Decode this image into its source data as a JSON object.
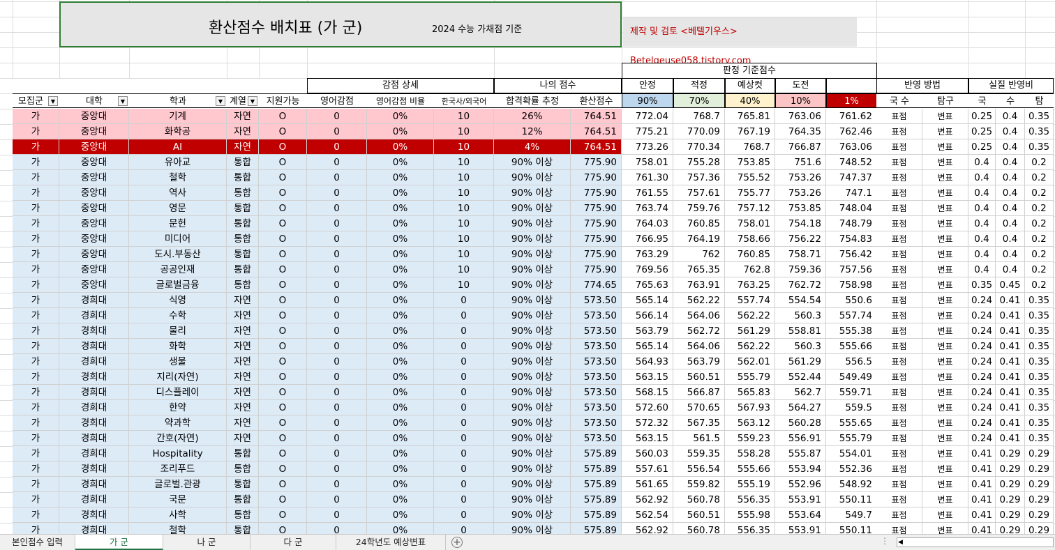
{
  "title": {
    "main": "환산점수 배치표 (가 군)",
    "sub": "2024 수능 가채점 기준",
    "credit": "제작 및 검토 <베텔기우스> Betelgeuse058.tistory.com"
  },
  "groups": {
    "judge": "판정 기준점수",
    "deduct": "감점 상세",
    "my": "나의 점수",
    "method": "반영 방법",
    "ratio": "실질 반영비"
  },
  "sub_headers": {
    "safe": "안정",
    "proper": "적정",
    "expect": "예상컷",
    "challenge": "도전"
  },
  "headers": {
    "group": "모집군",
    "univ": "대학",
    "dept": "학과",
    "track": "계열",
    "avail": "지원가능",
    "eng_deduct": "영어감점",
    "eng_ratio": "영어감점 비율",
    "korhist": "한국사/외국어",
    "prob": "합격확률 추정",
    "score": "환산점수",
    "m_ks": "국 수",
    "m_tam": "탐구",
    "r_kor": "국",
    "r_math": "수",
    "r_tam": "탐"
  },
  "judge_pcts": [
    "90%",
    "70%",
    "40%",
    "10%",
    "1%"
  ],
  "colors": {
    "pink": "#ffc7ce",
    "red": "#c00000",
    "blue": "#ddebf7",
    "safe": "#bdd7ee",
    "proper": "#e2efda",
    "expect": "#fff2cc",
    "challenge": "#fcc5c5"
  },
  "rows": [
    [
      "가",
      "중앙대",
      "기계",
      "자연",
      "O",
      "0",
      "0%",
      "10",
      "26%",
      "764.51",
      "772.04",
      "768.7",
      "765.81",
      "763.06",
      "761.62",
      "표점",
      "변표",
      "0.25",
      "0.4",
      "0.35",
      "pink"
    ],
    [
      "가",
      "중앙대",
      "화학공",
      "자연",
      "O",
      "0",
      "0%",
      "10",
      "12%",
      "764.51",
      "775.21",
      "770.09",
      "767.19",
      "764.35",
      "762.46",
      "표점",
      "변표",
      "0.25",
      "0.4",
      "0.35",
      "pink"
    ],
    [
      "가",
      "중앙대",
      "AI",
      "자연",
      "O",
      "0",
      "0%",
      "10",
      "4%",
      "764.51",
      "773.26",
      "770.34",
      "768.7",
      "766.87",
      "763.06",
      "표점",
      "변표",
      "0.25",
      "0.4",
      "0.35",
      "red"
    ],
    [
      "가",
      "중앙대",
      "유아교",
      "통합",
      "O",
      "0",
      "0%",
      "10",
      "90% 이상",
      "775.90",
      "758.01",
      "755.28",
      "753.85",
      "751.6",
      "748.52",
      "표점",
      "변표",
      "0.4",
      "0.4",
      "0.2",
      "blue"
    ],
    [
      "가",
      "중앙대",
      "철학",
      "통합",
      "O",
      "0",
      "0%",
      "10",
      "90% 이상",
      "775.90",
      "761.30",
      "757.36",
      "755.52",
      "753.26",
      "747.37",
      "표점",
      "변표",
      "0.4",
      "0.4",
      "0.2",
      "blue"
    ],
    [
      "가",
      "중앙대",
      "역사",
      "통합",
      "O",
      "0",
      "0%",
      "10",
      "90% 이상",
      "775.90",
      "761.55",
      "757.61",
      "755.77",
      "753.26",
      "747.1",
      "표점",
      "변표",
      "0.4",
      "0.4",
      "0.2",
      "blue"
    ],
    [
      "가",
      "중앙대",
      "영문",
      "통합",
      "O",
      "0",
      "0%",
      "10",
      "90% 이상",
      "775.90",
      "763.74",
      "759.76",
      "757.12",
      "753.85",
      "748.04",
      "표점",
      "변표",
      "0.4",
      "0.4",
      "0.2",
      "blue"
    ],
    [
      "가",
      "중앙대",
      "문헌",
      "통합",
      "O",
      "0",
      "0%",
      "10",
      "90% 이상",
      "775.90",
      "764.03",
      "760.85",
      "758.01",
      "754.18",
      "748.79",
      "표점",
      "변표",
      "0.4",
      "0.4",
      "0.2",
      "blue"
    ],
    [
      "가",
      "중앙대",
      "미디어",
      "통합",
      "O",
      "0",
      "0%",
      "10",
      "90% 이상",
      "775.90",
      "766.95",
      "764.19",
      "758.66",
      "756.22",
      "754.83",
      "표점",
      "변표",
      "0.4",
      "0.4",
      "0.2",
      "blue"
    ],
    [
      "가",
      "중앙대",
      "도시.부동산",
      "통합",
      "O",
      "0",
      "0%",
      "10",
      "90% 이상",
      "775.90",
      "763.29",
      "762",
      "760.85",
      "758.71",
      "756.42",
      "표점",
      "변표",
      "0.4",
      "0.4",
      "0.2",
      "blue"
    ],
    [
      "가",
      "중앙대",
      "공공인재",
      "통합",
      "O",
      "0",
      "0%",
      "10",
      "90% 이상",
      "775.90",
      "769.56",
      "765.35",
      "762.8",
      "759.36",
      "757.56",
      "표점",
      "변표",
      "0.4",
      "0.4",
      "0.2",
      "blue"
    ],
    [
      "가",
      "중앙대",
      "글로벌금융",
      "통합",
      "O",
      "0",
      "0%",
      "10",
      "90% 이상",
      "774.65",
      "765.63",
      "763.91",
      "763.25",
      "762.72",
      "758.98",
      "표점",
      "변표",
      "0.35",
      "0.45",
      "0.2",
      "blue"
    ],
    [
      "가",
      "경희대",
      "식영",
      "자연",
      "O",
      "0",
      "0%",
      "0",
      "90% 이상",
      "573.50",
      "565.14",
      "562.22",
      "557.74",
      "554.54",
      "550.6",
      "표점",
      "변표",
      "0.24",
      "0.41",
      "0.35",
      "blue"
    ],
    [
      "가",
      "경희대",
      "수학",
      "자연",
      "O",
      "0",
      "0%",
      "0",
      "90% 이상",
      "573.50",
      "566.14",
      "564.06",
      "562.22",
      "560.3",
      "557.74",
      "표점",
      "변표",
      "0.24",
      "0.41",
      "0.35",
      "blue"
    ],
    [
      "가",
      "경희대",
      "물리",
      "자연",
      "O",
      "0",
      "0%",
      "0",
      "90% 이상",
      "573.50",
      "563.79",
      "562.72",
      "561.29",
      "558.81",
      "555.38",
      "표점",
      "변표",
      "0.24",
      "0.41",
      "0.35",
      "blue"
    ],
    [
      "가",
      "경희대",
      "화학",
      "자연",
      "O",
      "0",
      "0%",
      "0",
      "90% 이상",
      "573.50",
      "565.14",
      "564.06",
      "562.22",
      "560.3",
      "555.66",
      "표점",
      "변표",
      "0.24",
      "0.41",
      "0.35",
      "blue"
    ],
    [
      "가",
      "경희대",
      "생물",
      "자연",
      "O",
      "0",
      "0%",
      "0",
      "90% 이상",
      "573.50",
      "564.93",
      "563.79",
      "562.01",
      "561.29",
      "556.5",
      "표점",
      "변표",
      "0.24",
      "0.41",
      "0.35",
      "blue"
    ],
    [
      "가",
      "경희대",
      "지리(자연)",
      "자연",
      "O",
      "0",
      "0%",
      "0",
      "90% 이상",
      "573.50",
      "563.15",
      "560.51",
      "555.79",
      "552.44",
      "549.49",
      "표점",
      "변표",
      "0.24",
      "0.41",
      "0.35",
      "blue"
    ],
    [
      "가",
      "경희대",
      "디스플레이",
      "자연",
      "O",
      "0",
      "0%",
      "0",
      "90% 이상",
      "573.50",
      "568.15",
      "566.87",
      "565.83",
      "562.7",
      "559.71",
      "표점",
      "변표",
      "0.24",
      "0.41",
      "0.35",
      "blue"
    ],
    [
      "가",
      "경희대",
      "한약",
      "자연",
      "O",
      "0",
      "0%",
      "0",
      "90% 이상",
      "573.50",
      "572.60",
      "570.65",
      "567.93",
      "564.27",
      "559.5",
      "표점",
      "변표",
      "0.24",
      "0.41",
      "0.35",
      "blue"
    ],
    [
      "가",
      "경희대",
      "약과학",
      "자연",
      "O",
      "0",
      "0%",
      "0",
      "90% 이상",
      "573.50",
      "572.32",
      "567.35",
      "563.12",
      "560.28",
      "555.65",
      "표점",
      "변표",
      "0.24",
      "0.41",
      "0.35",
      "blue"
    ],
    [
      "가",
      "경희대",
      "간호(자연)",
      "자연",
      "O",
      "0",
      "0%",
      "0",
      "90% 이상",
      "573.50",
      "563.15",
      "561.5",
      "559.23",
      "556.91",
      "555.79",
      "표점",
      "변표",
      "0.24",
      "0.41",
      "0.35",
      "blue"
    ],
    [
      "가",
      "경희대",
      "Hospitality",
      "통합",
      "O",
      "0",
      "0%",
      "0",
      "90% 이상",
      "575.89",
      "560.03",
      "559.35",
      "558.28",
      "555.87",
      "554.01",
      "표점",
      "변표",
      "0.41",
      "0.29",
      "0.29",
      "blue"
    ],
    [
      "가",
      "경희대",
      "조리푸드",
      "통합",
      "O",
      "0",
      "0%",
      "0",
      "90% 이상",
      "575.89",
      "557.61",
      "556.54",
      "555.66",
      "553.94",
      "552.36",
      "표점",
      "변표",
      "0.41",
      "0.29",
      "0.29",
      "blue"
    ],
    [
      "가",
      "경희대",
      "글로벌.관광",
      "통합",
      "O",
      "0",
      "0%",
      "0",
      "90% 이상",
      "575.89",
      "561.65",
      "559.82",
      "555.19",
      "552.96",
      "548.92",
      "표점",
      "변표",
      "0.41",
      "0.29",
      "0.29",
      "blue"
    ],
    [
      "가",
      "경희대",
      "국문",
      "통합",
      "O",
      "0",
      "0%",
      "0",
      "90% 이상",
      "575.89",
      "562.92",
      "560.78",
      "556.35",
      "553.91",
      "550.11",
      "표점",
      "변표",
      "0.41",
      "0.29",
      "0.29",
      "blue"
    ],
    [
      "가",
      "경희대",
      "사학",
      "통합",
      "O",
      "0",
      "0%",
      "0",
      "90% 이상",
      "575.89",
      "562.54",
      "560.51",
      "555.98",
      "553.64",
      "549.7",
      "표점",
      "변표",
      "0.41",
      "0.29",
      "0.29",
      "blue"
    ],
    [
      "가",
      "경희대",
      "철학",
      "통합",
      "O",
      "0",
      "0%",
      "0",
      "90% 이상",
      "575.89",
      "562.92",
      "560.78",
      "556.35",
      "553.91",
      "550.11",
      "표점",
      "변표",
      "0.41",
      "0.29",
      "0.29",
      "blue"
    ]
  ],
  "tabs": [
    "본인점수 입력",
    "가 군",
    "나 군",
    "다 군",
    "24학년도 예상변표"
  ],
  "add_sheet": "+"
}
